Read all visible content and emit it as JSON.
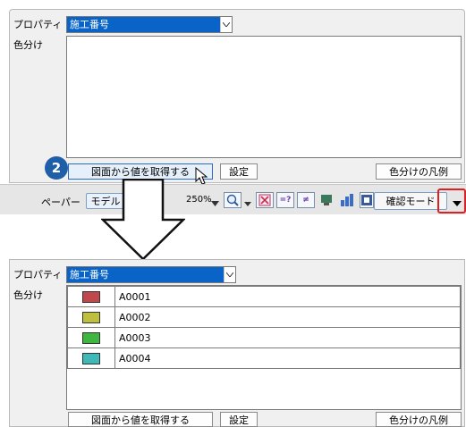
{
  "top_panel": {
    "property_label": "プロパティ",
    "property_value": "施工番号",
    "color_label": "色分け",
    "step_number": "2",
    "get_values_button": "図面から値を取得する",
    "settings_button": "設定",
    "legend_button": "色分けの凡例"
  },
  "toolbar": {
    "paper_label": "ペーパー",
    "model_tab": "モデル",
    "zoom": "250%",
    "confirm_mode": "確認モード"
  },
  "bottom_panel": {
    "property_label": "プロパティ",
    "property_value": "施工番号",
    "color_label": "色分け",
    "rows": [
      {
        "code": "A0001",
        "color": "#c0474b"
      },
      {
        "code": "A0002",
        "color": "#bfbf3e"
      },
      {
        "code": "A0003",
        "color": "#3fb63f"
      },
      {
        "code": "A0004",
        "color": "#3fb8b8"
      }
    ],
    "get_values_button": "図面から値を取得する",
    "settings_button": "設定",
    "legend_button": "色分けの凡例"
  }
}
